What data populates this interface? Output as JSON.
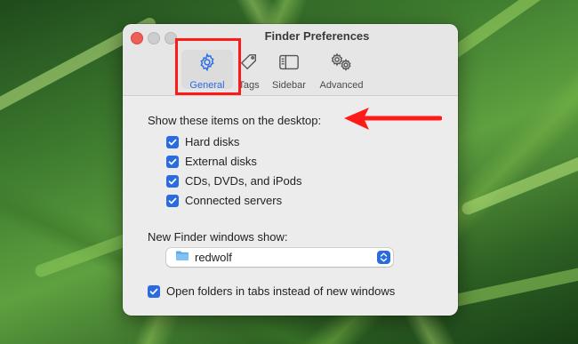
{
  "window": {
    "title": "Finder Preferences"
  },
  "toolbar": {
    "tabs": [
      {
        "label": "General",
        "icon": "gear-icon",
        "active": true
      },
      {
        "label": "Tags",
        "icon": "tag-icon",
        "active": false
      },
      {
        "label": "Sidebar",
        "icon": "sidebar-icon",
        "active": false
      },
      {
        "label": "Advanced",
        "icon": "gears-icon",
        "active": false
      }
    ]
  },
  "desktop_items": {
    "heading": "Show these items on the desktop:",
    "options": [
      {
        "label": "Hard disks",
        "checked": true
      },
      {
        "label": "External disks",
        "checked": true
      },
      {
        "label": "CDs, DVDs, and iPods",
        "checked": true
      },
      {
        "label": "Connected servers",
        "checked": true
      }
    ]
  },
  "new_window": {
    "label": "New Finder windows show:",
    "value": "redwolf"
  },
  "open_in_tabs": {
    "label": "Open folders in tabs instead of new windows",
    "checked": true
  },
  "colors": {
    "accent": "#2a6be3",
    "annotation": "#ff1a1a"
  }
}
